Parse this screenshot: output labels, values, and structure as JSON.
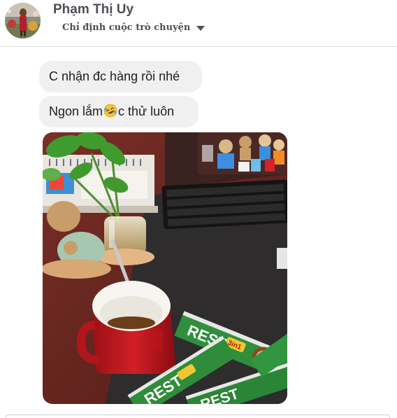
{
  "header": {
    "contact_name": "Phạm Thị Uy",
    "subtitle": "Chỉ định cuộc trò chuyện"
  },
  "messages": [
    {
      "text": "C nhận đc hàng rồi nhé"
    },
    {
      "text_before": "Ngon lắm",
      "emoji": "rofl-emoji",
      "text_after": "c thử luôn"
    }
  ],
  "photo": {
    "icons": {
      "mug": "coffee-mug",
      "sachet": "coffee-sachet"
    },
    "sachet_text": "REST",
    "sachet_badge": "3in1"
  },
  "colors": {
    "bubble_bg": "#f1f0f0",
    "name_text": "#4b4f56",
    "divider": "#dddfe2"
  }
}
